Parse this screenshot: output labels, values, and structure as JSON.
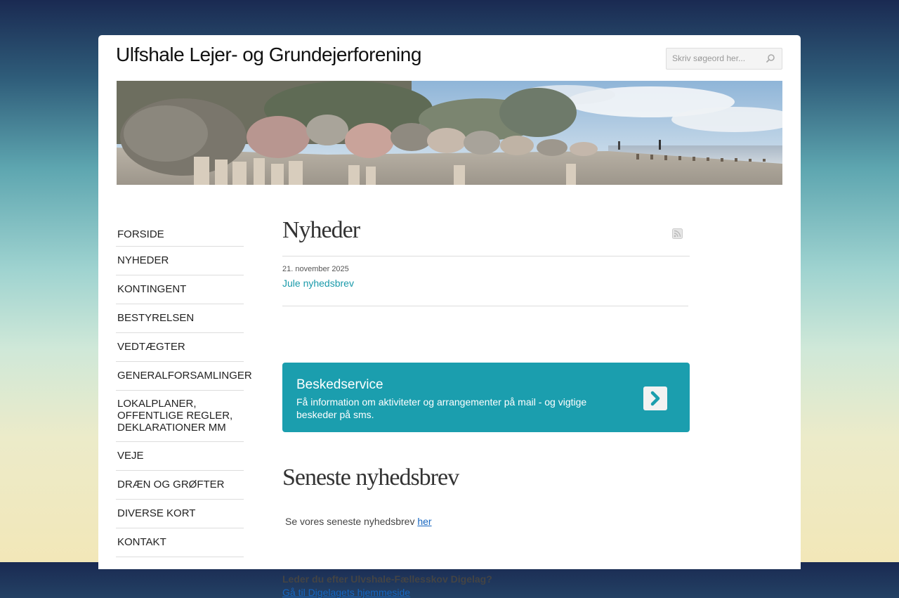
{
  "site": {
    "title": "Ulfshale Lejer- og Grundejerforening"
  },
  "search": {
    "placeholder": "Skriv søgeord her...",
    "icon": "search-icon"
  },
  "nav": {
    "items": [
      "FORSIDE",
      "NYHEDER",
      "KONTINGENT",
      "BESTYRELSEN",
      "VEDTÆGTER",
      "GENERALFORSAMLINGER",
      "LOKALPLANER,\nOFFENTLIGE REGLER,\nDEKLARATIONER MM",
      "VEJE",
      "DRÆN OG GRØFTER",
      "DIVERSE KORT",
      "KONTAKT"
    ]
  },
  "news": {
    "heading": "Nyheder",
    "rss_icon": "rss-icon",
    "items": [
      {
        "date": "21. november 2025",
        "title": "Jule nyhedsbrev"
      }
    ]
  },
  "message_service": {
    "title": "Beskedservice",
    "text": "Få information om aktiviteter og arrangementer på mail - og vigtige beskeder på sms.",
    "button_icon": "chevron-right-icon"
  },
  "latest_newsletter": {
    "heading": "Seneste nyhedsbrev",
    "text": "Se vores seneste nyhedsbrev ",
    "link": "her "
  },
  "dike": {
    "question": "Leder du efter Ulvshale-Fællesskov Digelag?",
    "link": "Gå til Digelagets hjemmeside"
  },
  "colors": {
    "accent": "#1b9eae",
    "link": "#1565c0",
    "news_link": "#1a9aaa"
  }
}
